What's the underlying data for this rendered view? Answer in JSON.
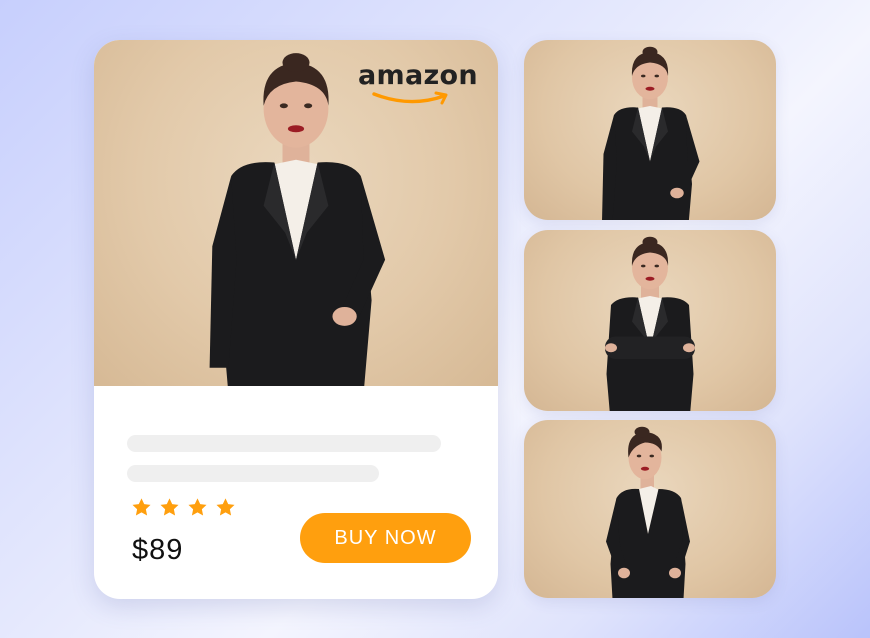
{
  "product": {
    "brand_logo_text": "amazon",
    "rating_stars": 4,
    "price": "$89",
    "buy_label": "BUY NOW"
  },
  "colors": {
    "accent": "#ff9f0e",
    "star": "#ff9f0e",
    "skeleton": "#efefef",
    "backdrop": "#e2c9a9"
  },
  "icons": [
    "amazon-logo",
    "star-icon"
  ],
  "thumbnails": [
    {
      "pose": "standing-front"
    },
    {
      "pose": "arms-crossed"
    },
    {
      "pose": "side-hand-on-hip"
    }
  ]
}
